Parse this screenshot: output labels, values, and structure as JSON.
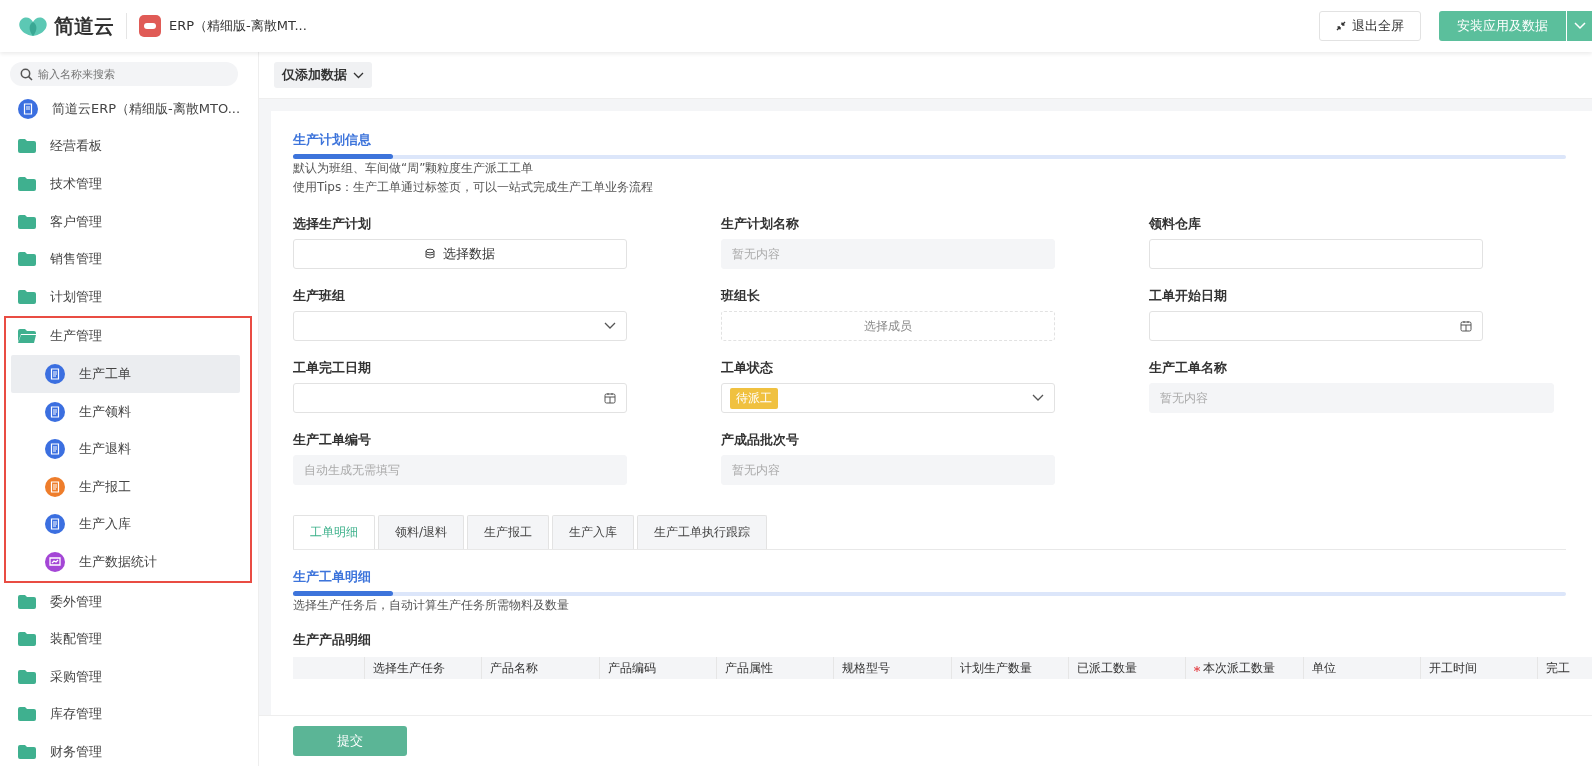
{
  "header": {
    "brand": "简道云",
    "app_title": "ERP（精细版-离散MT...",
    "exit_button": "退出全屏",
    "install_button": "安装应用及数据"
  },
  "sidebar": {
    "search": {
      "placeholder": "输入名称来搜索"
    },
    "items": [
      {
        "label": "简道云ERP（精细版-离散MTO...",
        "kind": "form",
        "color": "#3b6fe0",
        "selected": false
      },
      {
        "label": "经营看板",
        "kind": "folder",
        "expanded": false,
        "selected": false
      },
      {
        "label": "技术管理",
        "kind": "folder",
        "expanded": false,
        "selected": false
      },
      {
        "label": "客户管理",
        "kind": "folder",
        "expanded": false,
        "selected": false
      },
      {
        "label": "销售管理",
        "kind": "folder",
        "expanded": false,
        "selected": false
      },
      {
        "label": "计划管理",
        "kind": "folder",
        "expanded": false,
        "selected": false
      },
      {
        "label": "生产管理",
        "kind": "folder",
        "expanded": true,
        "selected": false,
        "highlighted": true,
        "children": [
          {
            "label": "生产工单",
            "kind": "form",
            "color": "#3b6fe0",
            "selected": true
          },
          {
            "label": "生产领料",
            "kind": "form",
            "color": "#3b6fe0",
            "selected": false
          },
          {
            "label": "生产退料",
            "kind": "form",
            "color": "#3b6fe0",
            "selected": false
          },
          {
            "label": "生产报工",
            "kind": "form",
            "color": "#ee7d2b",
            "selected": false
          },
          {
            "label": "生产入库",
            "kind": "form",
            "color": "#3b6fe0",
            "selected": false
          },
          {
            "label": "生产数据统计",
            "kind": "chart",
            "color": "#a446d6",
            "selected": false
          }
        ]
      },
      {
        "label": "委外管理",
        "kind": "folder",
        "expanded": false,
        "selected": false
      },
      {
        "label": "装配管理",
        "kind": "folder",
        "expanded": false,
        "selected": false
      },
      {
        "label": "采购管理",
        "kind": "folder",
        "expanded": false,
        "selected": false
      },
      {
        "label": "库存管理",
        "kind": "folder",
        "expanded": false,
        "selected": false
      },
      {
        "label": "财务管理",
        "kind": "folder",
        "expanded": false,
        "selected": false
      }
    ]
  },
  "toolbar": {
    "mode_button": "仅添加数据"
  },
  "section": {
    "title": "生产计划信息",
    "notes": [
      "默认为班组、车间做“周”颗粒度生产派工工单",
      "使用Tips：生产工单通过标签页，可以一站式完成生产工单业务流程"
    ]
  },
  "fields": [
    {
      "label": "选择生产计划",
      "kind": "button",
      "value": "选择数据"
    },
    {
      "label": "生产计划名称",
      "kind": "readonly",
      "placeholder": "暂无内容"
    },
    {
      "label": "领料仓库",
      "kind": "input"
    },
    {
      "label": "生产班组",
      "kind": "select"
    },
    {
      "label": "班组长",
      "kind": "member",
      "placeholder": "选择成员"
    },
    {
      "label": "工单开始日期",
      "kind": "date"
    },
    {
      "label": "工单完工日期",
      "kind": "date"
    },
    {
      "label": "工单状态",
      "kind": "status",
      "value": "待派工"
    },
    {
      "label": "生产工单名称",
      "kind": "readonly",
      "placeholder": "暂无内容"
    },
    {
      "label": "生产工单编号",
      "kind": "readonly",
      "placeholder": "自动生成无需填写"
    },
    {
      "label": "产成品批次号",
      "kind": "readonly",
      "placeholder": "暂无内容"
    }
  ],
  "tabs": [
    {
      "label": "工单明细",
      "selected": true
    },
    {
      "label": "领料/退料",
      "selected": false
    },
    {
      "label": "生产报工",
      "selected": false
    },
    {
      "label": "生产入库",
      "selected": false
    },
    {
      "label": "生产工单执行跟踪",
      "selected": false
    }
  ],
  "detail": {
    "title": "生产工单明细",
    "note": "选择生产任务后，自动计算生产任务所需物料及数量",
    "table_title": "生产产品明细",
    "columns": [
      {
        "required": false
      },
      {
        "label": "选择生产任务",
        "required": false
      },
      {
        "label": "产品名称",
        "required": false
      },
      {
        "label": "产品编码",
        "required": false
      },
      {
        "label": "产品属性",
        "required": false
      },
      {
        "label": "规格型号",
        "required": false
      },
      {
        "label": "计划生产数量",
        "required": false
      },
      {
        "label": "已派工数量",
        "required": false
      },
      {
        "label": "本次派工数量",
        "required": true
      },
      {
        "label": "单位",
        "required": false
      },
      {
        "label": "开工时间",
        "required": false
      },
      {
        "label": "完工",
        "required": false
      }
    ]
  },
  "footer": {
    "submit_button": "提交"
  }
}
